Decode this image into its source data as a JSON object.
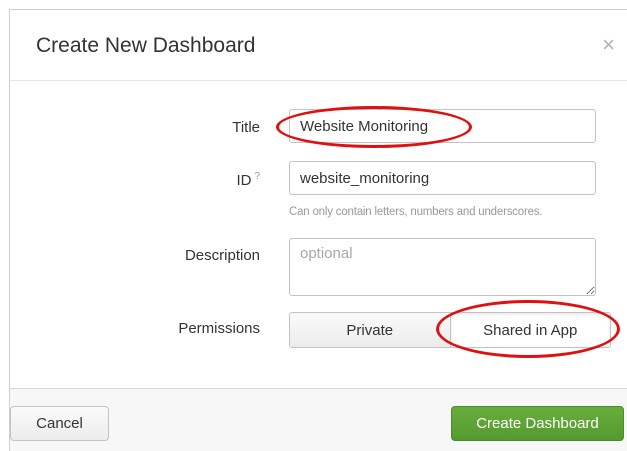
{
  "dialog": {
    "title": "Create New Dashboard",
    "close_symbol": "×"
  },
  "form": {
    "title_label": "Title",
    "title_value": "Website Monitoring",
    "id_label": "ID",
    "id_help_symbol": "?",
    "id_value": "website_monitoring",
    "id_help_text": "Can only contain letters, numbers and underscores.",
    "description_label": "Description",
    "description_placeholder": "optional",
    "permissions_label": "Permissions",
    "permissions_options": [
      "Private",
      "Shared in App"
    ],
    "permissions_selected": "Shared in App"
  },
  "footer": {
    "cancel_label": "Cancel",
    "create_label": "Create Dashboard",
    "create_color": "#5ba334"
  },
  "annotations": {
    "highlight_color": "#e01010"
  }
}
